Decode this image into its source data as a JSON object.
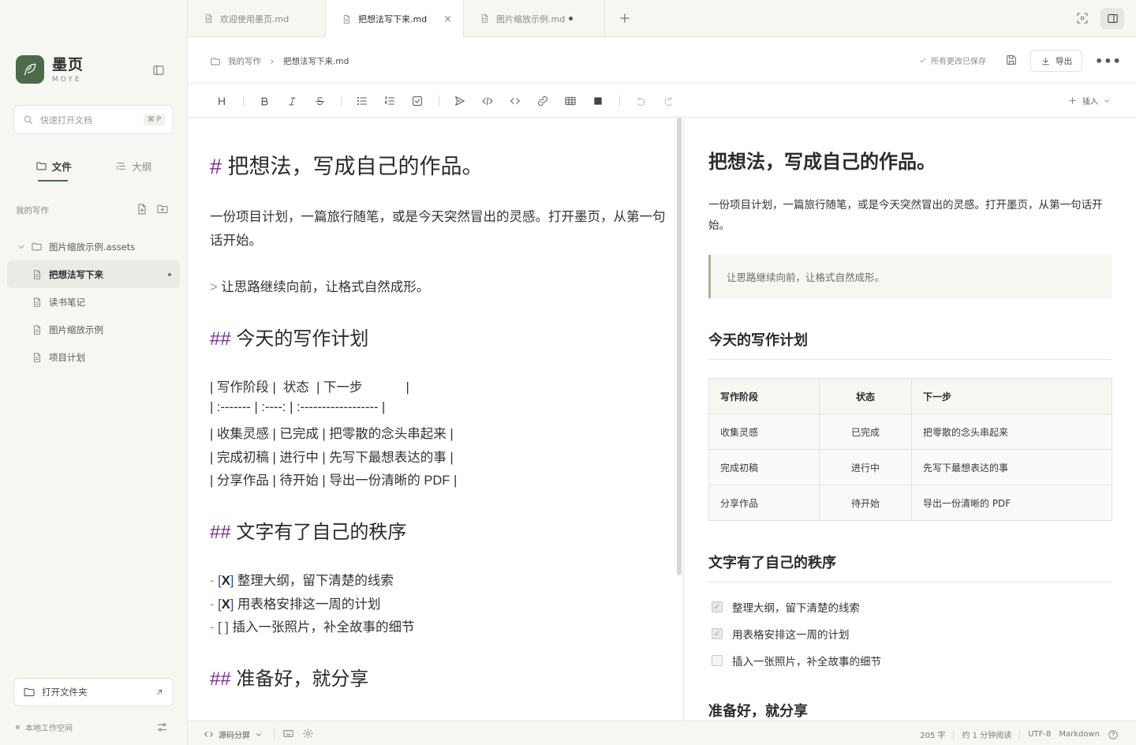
{
  "app": {
    "name": "墨页",
    "subtitle": "MOYE"
  },
  "sidebar": {
    "search_placeholder": "快速打开文档",
    "search_shortcut": "⌘ P",
    "tabs": [
      {
        "label": "文件",
        "active": true
      },
      {
        "label": "大纲",
        "active": false
      }
    ],
    "section_label": "我的写作",
    "tree": [
      {
        "label": "图片缩放示例.assets",
        "type": "folder",
        "expanded": true
      },
      {
        "label": "把想法写下来",
        "type": "file",
        "active": true,
        "modified": true
      },
      {
        "label": "读书笔记",
        "type": "file"
      },
      {
        "label": "图片缩放示例",
        "type": "file"
      },
      {
        "label": "项目计划",
        "type": "file"
      }
    ],
    "open_folder_label": "打开文件夹",
    "workspace_label": "本地工作空间"
  },
  "tabs": [
    {
      "label": "欢迎使用墨页.md",
      "active": false
    },
    {
      "label": "把想法写下来.md",
      "active": true,
      "close": "×"
    },
    {
      "label": "图片缩放示例.md",
      "active": false,
      "modified": true
    }
  ],
  "header": {
    "breadcrumb_root": "我的写作",
    "breadcrumb_current": "把想法写下来.md",
    "saved_status": "所有更改已保存",
    "export_label": "导出",
    "more_label": "•••"
  },
  "toolbar": {
    "heading": "H",
    "insert_label": "插入"
  },
  "editor": {
    "h1_mark": "#",
    "h1_text": "把想法，写成自己的作品。",
    "para_line1": "一份项目计划，一篇旅行随笔，或是今天突然冒出的灵感。打开墨页，从第一句",
    "para_line2": "话开始。",
    "quote_mark": ">",
    "quote_text": "让思路继续向前，让格式自然成形。",
    "h2_mark": "##",
    "h2_plan": "今天的写作计划",
    "table_lines": [
      "| 写作阶段 |  状态  | 下一步            |",
      "| :------- | :----: | :------------------ |",
      "| 收集灵感 | 已完成 | 把零散的念头串起来 |",
      "| 完成初稿 | 进行中 | 先写下最想表达的事 |",
      "| 分享作品 | 待开始 | 导出一份清晰的 PDF |"
    ],
    "h2_order": "文字有了自己的秩序",
    "list_mark": "-",
    "tasks": [
      {
        "open": "[",
        "mark": "X",
        "close": "]",
        "text": "整理大纲，留下清楚的线索"
      },
      {
        "open": "[",
        "mark": "X",
        "close": "]",
        "text": "用表格安排这一周的计划"
      },
      {
        "open": "[",
        "mark": " ",
        "close": "]",
        "text": "插入一张照片，补全故事的细节"
      }
    ],
    "h2_share": "准备好，就分享"
  },
  "preview": {
    "h1": "把想法，写成自己的作品。",
    "para": "一份项目计划，一篇旅行随笔，或是今天突然冒出的灵感。打开墨页，从第一句话开始。",
    "quote": "让思路继续向前，让格式自然成形。",
    "h2_plan": "今天的写作计划",
    "table": {
      "headers": [
        "写作阶段",
        "状态",
        "下一步"
      ],
      "rows": [
        [
          "收集灵感",
          "已完成",
          "把零散的念头串起来"
        ],
        [
          "完成初稿",
          "进行中",
          "先写下最想表达的事"
        ],
        [
          "分享作品",
          "待开始",
          "导出一份清晰的 PDF"
        ]
      ]
    },
    "h2_order": "文字有了自己的秩序",
    "tasks": [
      {
        "text": "整理大纲，留下清楚的线索",
        "checked": true
      },
      {
        "text": "用表格安排这一周的计划",
        "checked": true
      },
      {
        "text": "插入一张照片，补全故事的细节",
        "checked": false
      }
    ],
    "h2_share": "准备好，就分享"
  },
  "statusbar": {
    "mode": "源码分屏",
    "word_count": "205 字",
    "reading_time": "约 1 分钟阅读",
    "encoding": "UTF-8",
    "language": "Markdown"
  },
  "colors": {
    "accent": "#4d6b4a",
    "markdown_mark": "#7a2d8c",
    "task_mark": "#2d4aa0"
  }
}
